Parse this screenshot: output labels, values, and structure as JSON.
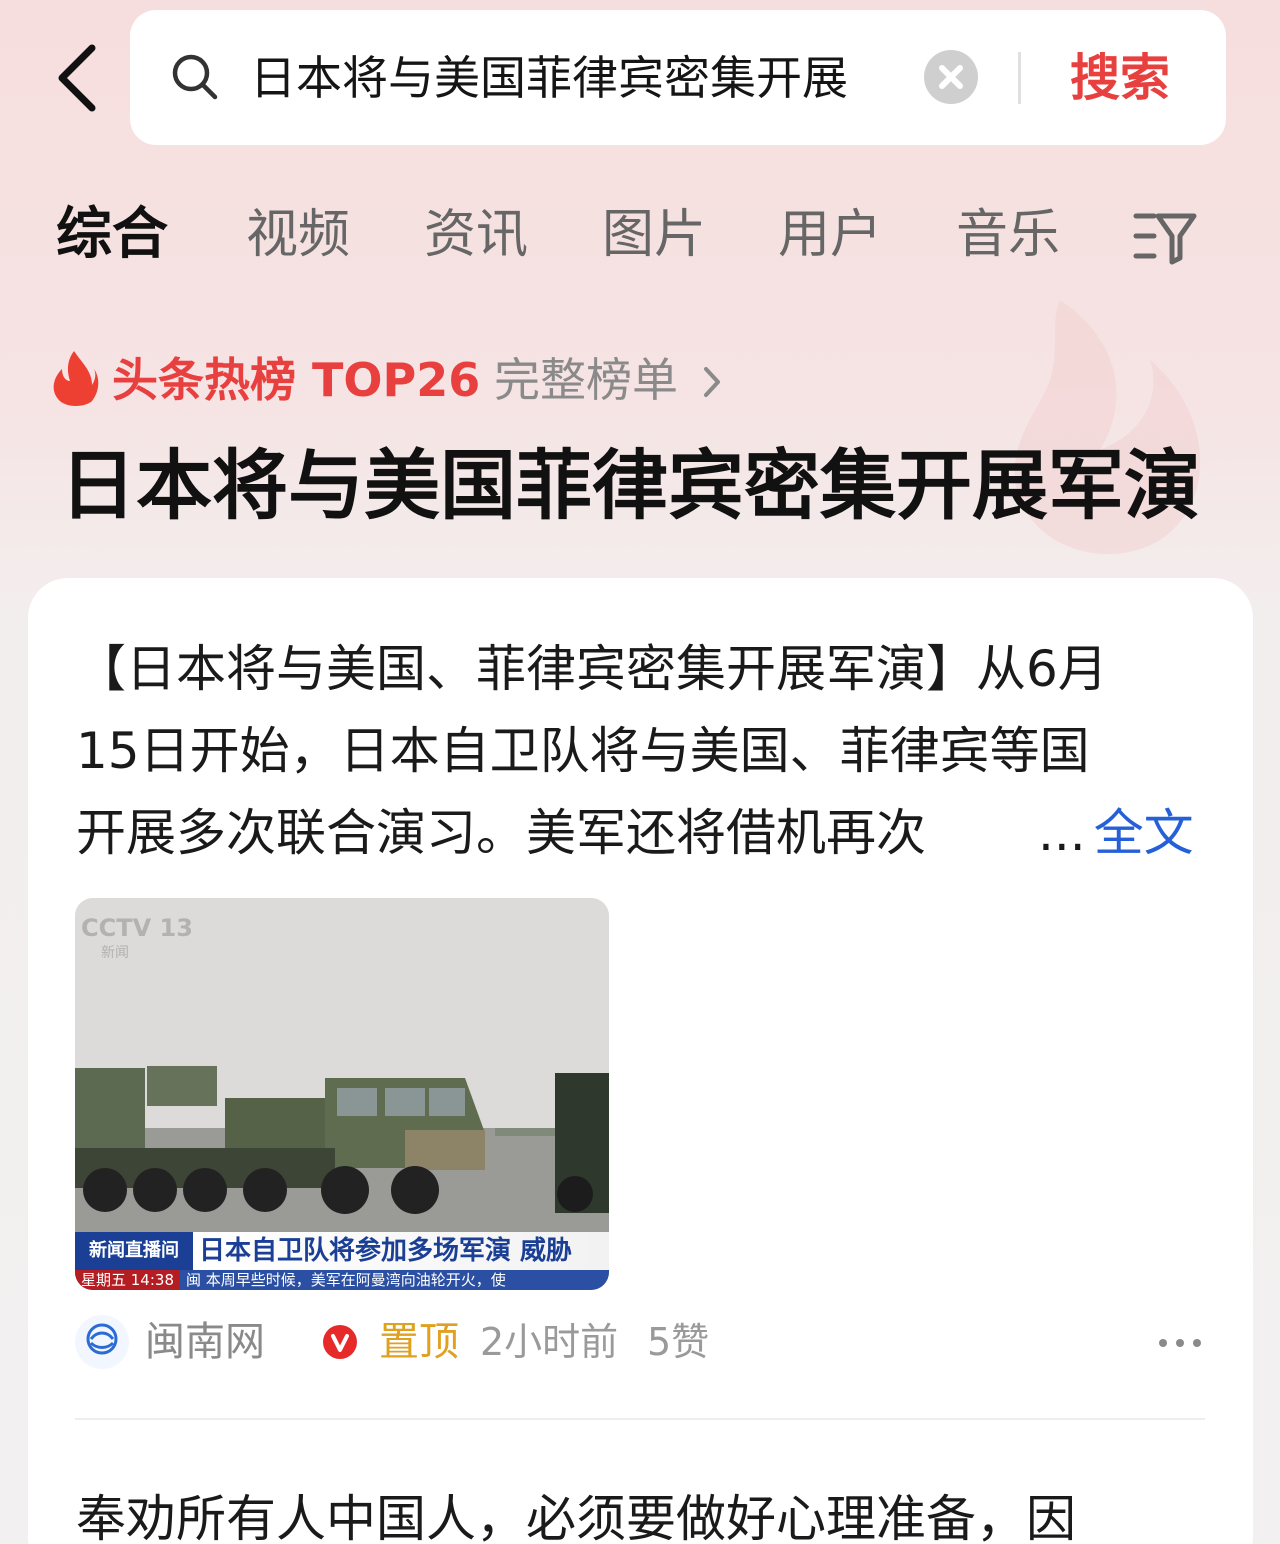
{
  "search": {
    "query": "日本将与美国菲律宾密集开展",
    "submit_label": "搜索"
  },
  "tabs": [
    {
      "label": "综合",
      "active": true
    },
    {
      "label": "视频",
      "active": false
    },
    {
      "label": "资讯",
      "active": false
    },
    {
      "label": "图片",
      "active": false
    },
    {
      "label": "用户",
      "active": false
    },
    {
      "label": "音乐",
      "active": false
    }
  ],
  "hot": {
    "label": "头条热榜 TOP26",
    "link_label": "完整榜单",
    "topic_title": "日本将与美国菲律宾密集开展军演"
  },
  "post": {
    "lines": [
      "【日本将与美国、菲律宾密集开展军演】从6月",
      "15日开始，日本自卫队将与美国、菲律宾等国",
      "开展多次联合演习。美军还将借机再次"
    ],
    "ellipsis": "...",
    "full_label": "全文",
    "image": {
      "channel_logo": "CCTV 13",
      "channel_sub": "新闻",
      "caption_tag": "新闻直播间",
      "caption": "日本自卫队将参加多场军演 威胁",
      "ticker_time": "星期五 14:38",
      "ticker": "闽 本周早些时候，美军在阿曼湾向油轮开火，使"
    },
    "source": "闽南网",
    "source_avatar_text": "闽南网",
    "pinned_label": "置顶",
    "time_ago": "2小时前",
    "likes": "5赞"
  },
  "next_post": {
    "text": "奉劝所有人中国人，必须要做好心理准备，因"
  },
  "colors": {
    "accent_red": "#e8403f",
    "link_blue": "#2560d8",
    "pinned_orange": "#e0a020"
  }
}
